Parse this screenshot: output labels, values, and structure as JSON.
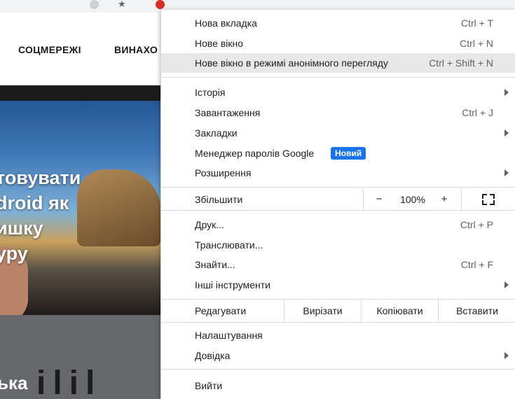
{
  "page": {
    "nav": {
      "social": "СОЦМЕРЕЖІ",
      "win": "ВИНАХО"
    },
    "hero_title": "товувати\ndroid як\nишку\nуру",
    "lower_title": "ька",
    "lower_glyphs": "ilil"
  },
  "menu": {
    "new_tab": {
      "label": "Нова вкладка",
      "shortcut": "Ctrl + T"
    },
    "new_window": {
      "label": "Нове вікно",
      "shortcut": "Ctrl + N"
    },
    "incognito": {
      "label": "Нове вікно в режимі анонімного перегляду",
      "shortcut": "Ctrl + Shift + N"
    },
    "history": {
      "label": "Історія"
    },
    "downloads": {
      "label": "Завантаження",
      "shortcut": "Ctrl + J"
    },
    "bookmarks": {
      "label": "Закладки"
    },
    "password_manager": {
      "label": "Менеджер паролів Google",
      "badge": "Новий"
    },
    "extensions": {
      "label": "Розширення"
    },
    "zoom": {
      "label": "Збільшити",
      "minus": "−",
      "value": "100%",
      "plus": "+"
    },
    "print": {
      "label": "Друк...",
      "shortcut": "Ctrl + P"
    },
    "cast": {
      "label": "Транслювати..."
    },
    "find": {
      "label": "Знайти...",
      "shortcut": "Ctrl + F"
    },
    "more_tools": {
      "label": "Інші інструменти"
    },
    "edit": {
      "label": "Редагувати",
      "cut": "Вирізати",
      "copy": "Копіювати",
      "paste": "Вставити"
    },
    "settings": {
      "label": "Налаштування"
    },
    "help": {
      "label": "Довідка"
    },
    "exit": {
      "label": "Вийти"
    }
  },
  "colors": {
    "highlight": "#e8e8e9",
    "badge": "#1a73e8",
    "separator": "#dadce0"
  }
}
